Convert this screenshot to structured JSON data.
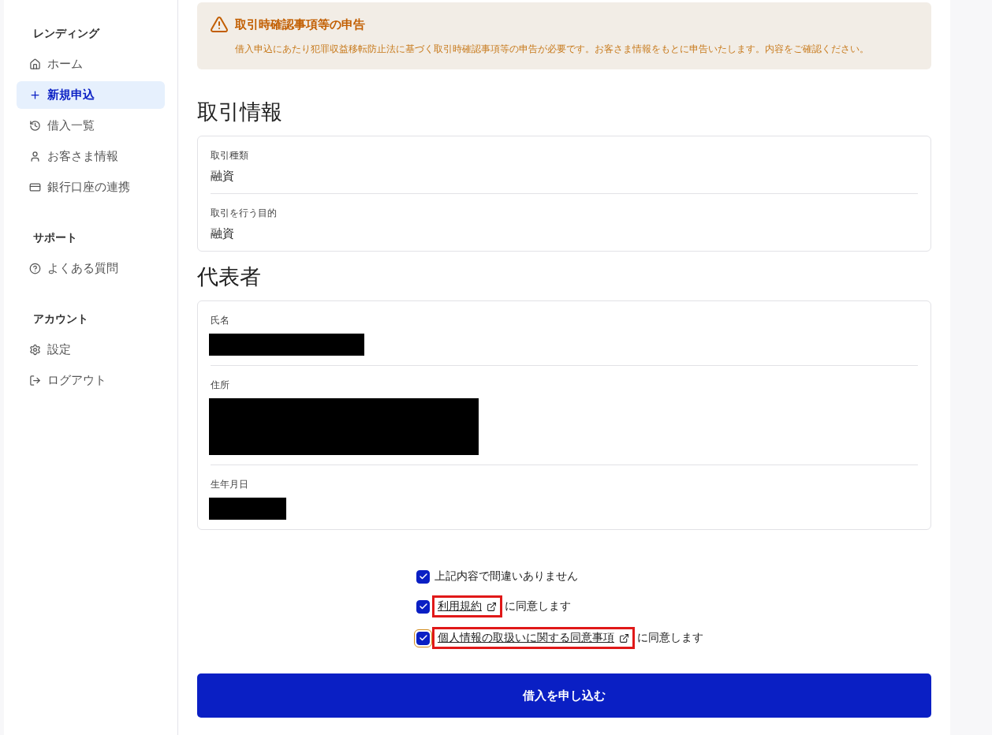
{
  "sidebar": {
    "sections": [
      {
        "heading": "レンディング",
        "items": [
          {
            "label": "ホーム",
            "selected": false
          },
          {
            "label": "新規申込",
            "selected": true
          },
          {
            "label": "借入一覧",
            "selected": false
          },
          {
            "label": "お客さま情報",
            "selected": false
          },
          {
            "label": "銀行口座の連携",
            "selected": false
          }
        ]
      },
      {
        "heading": "サポート",
        "items": [
          {
            "label": "よくある質問",
            "selected": false
          }
        ]
      },
      {
        "heading": "アカウント",
        "items": [
          {
            "label": "設定",
            "selected": false
          },
          {
            "label": "ログアウト",
            "selected": false
          }
        ]
      }
    ]
  },
  "notice": {
    "title": "取引時確認事項等の申告",
    "body": "借入申込にあたり犯罪収益移転防止法に基づく取引時確認事項等の申告が必要です。お客さま情報をもとに申告いたします。内容をご確認ください。"
  },
  "sections": [
    {
      "title": "取引情報",
      "fields": [
        {
          "label": "取引種類",
          "value": "融資",
          "redacted": false
        },
        {
          "label": "取引を行う目的",
          "value": "融資",
          "redacted": false
        }
      ]
    },
    {
      "title": "代表者",
      "fields": [
        {
          "label": "氏名",
          "redacted": true
        },
        {
          "label": "住所",
          "redacted": true
        },
        {
          "label": "生年月日",
          "redacted": true
        }
      ]
    }
  ],
  "agreements": [
    {
      "checked": true,
      "focused": false,
      "text": "上記内容で間違いありません"
    },
    {
      "checked": true,
      "focused": false,
      "link": "利用規約",
      "highlighted": true,
      "text": "に同意します"
    },
    {
      "checked": true,
      "focused": true,
      "link": "個人情報の取扱いに関する同意事項",
      "highlighted": true,
      "text": "に同意します"
    }
  ],
  "submit": {
    "label": "借入を申し込む"
  }
}
